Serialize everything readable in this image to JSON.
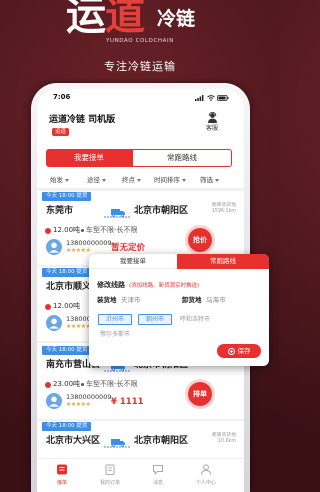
{
  "logo": {
    "char1": "运",
    "char2": "道",
    "sub": "冷链",
    "en": "YUNDAO COLDCHAIN"
  },
  "tagline": "专注冷链运输",
  "status": {
    "time": "7:06"
  },
  "header": {
    "title": "运道冷链 司机版",
    "badge": "运道",
    "service_label": "客服"
  },
  "tabs": [
    {
      "label": "我要接单",
      "active": true
    },
    {
      "label": "常跑路线",
      "active": false
    }
  ],
  "filters": [
    "始发",
    "途径",
    "终点",
    "时间排序",
    "筛选"
  ],
  "orders": [
    {
      "tag": "今天 18:00 提货",
      "from": "东莞市",
      "to": "北京市朝阳区",
      "distance_label": "距离装货地",
      "distance": "1596.1km",
      "weight": "12.00吨",
      "vehicle": "车型不限-长不限",
      "phone": "13800000009",
      "stars": "★★★★★",
      "price": "暂无定价",
      "action": "抢价"
    },
    {
      "tag": "今天 18:00 提货",
      "from": "北京市顺义区",
      "weight": "12.00吨",
      "phone": "13800000009",
      "stars": "★★★★★"
    },
    {
      "tag": "今天 18:00 提货",
      "from": "南充市营山县",
      "to": "北京市朝阳区",
      "weight": "23.00吨",
      "vehicle": "车型不限-长不限",
      "phone": "13800000009",
      "stars": "★★★★★",
      "price": "¥ 1111",
      "action": "排单"
    },
    {
      "tag": "今天 18:00 提货",
      "from": "北京市大兴区",
      "to": "北京市朝阳区",
      "distance_label": "距离装货地",
      "distance": "10.6km"
    }
  ],
  "popup": {
    "tabs": [
      {
        "label": "我要接单",
        "active": false
      },
      {
        "label": "常跑路线",
        "active": true
      }
    ],
    "title": "修改线路",
    "hint": "(添加线路、新货源实时推送)",
    "load_label": "装货地",
    "load_value": "天津市",
    "unload_label": "卸货地",
    "unload_value": "乌海市",
    "selected_cities": [
      "沂州市",
      "朝州市"
    ],
    "other_cities": [
      "呼和浩特市",
      "鄂尔多斯市"
    ],
    "save": "保存"
  },
  "bottom_nav": [
    {
      "label": "接单",
      "icon": "take-order-icon",
      "active": true
    },
    {
      "label": "我的订单",
      "icon": "orders-icon",
      "active": false
    },
    {
      "label": "消息",
      "icon": "message-icon",
      "active": false
    },
    {
      "label": "个人中心",
      "icon": "profile-icon",
      "active": false
    }
  ],
  "colors": {
    "brand_red": "#e8312f",
    "tag_blue": "#3d8ee6",
    "background": "#521920",
    "star": "#f5a623",
    "chip_blue": "#4a90e2"
  }
}
